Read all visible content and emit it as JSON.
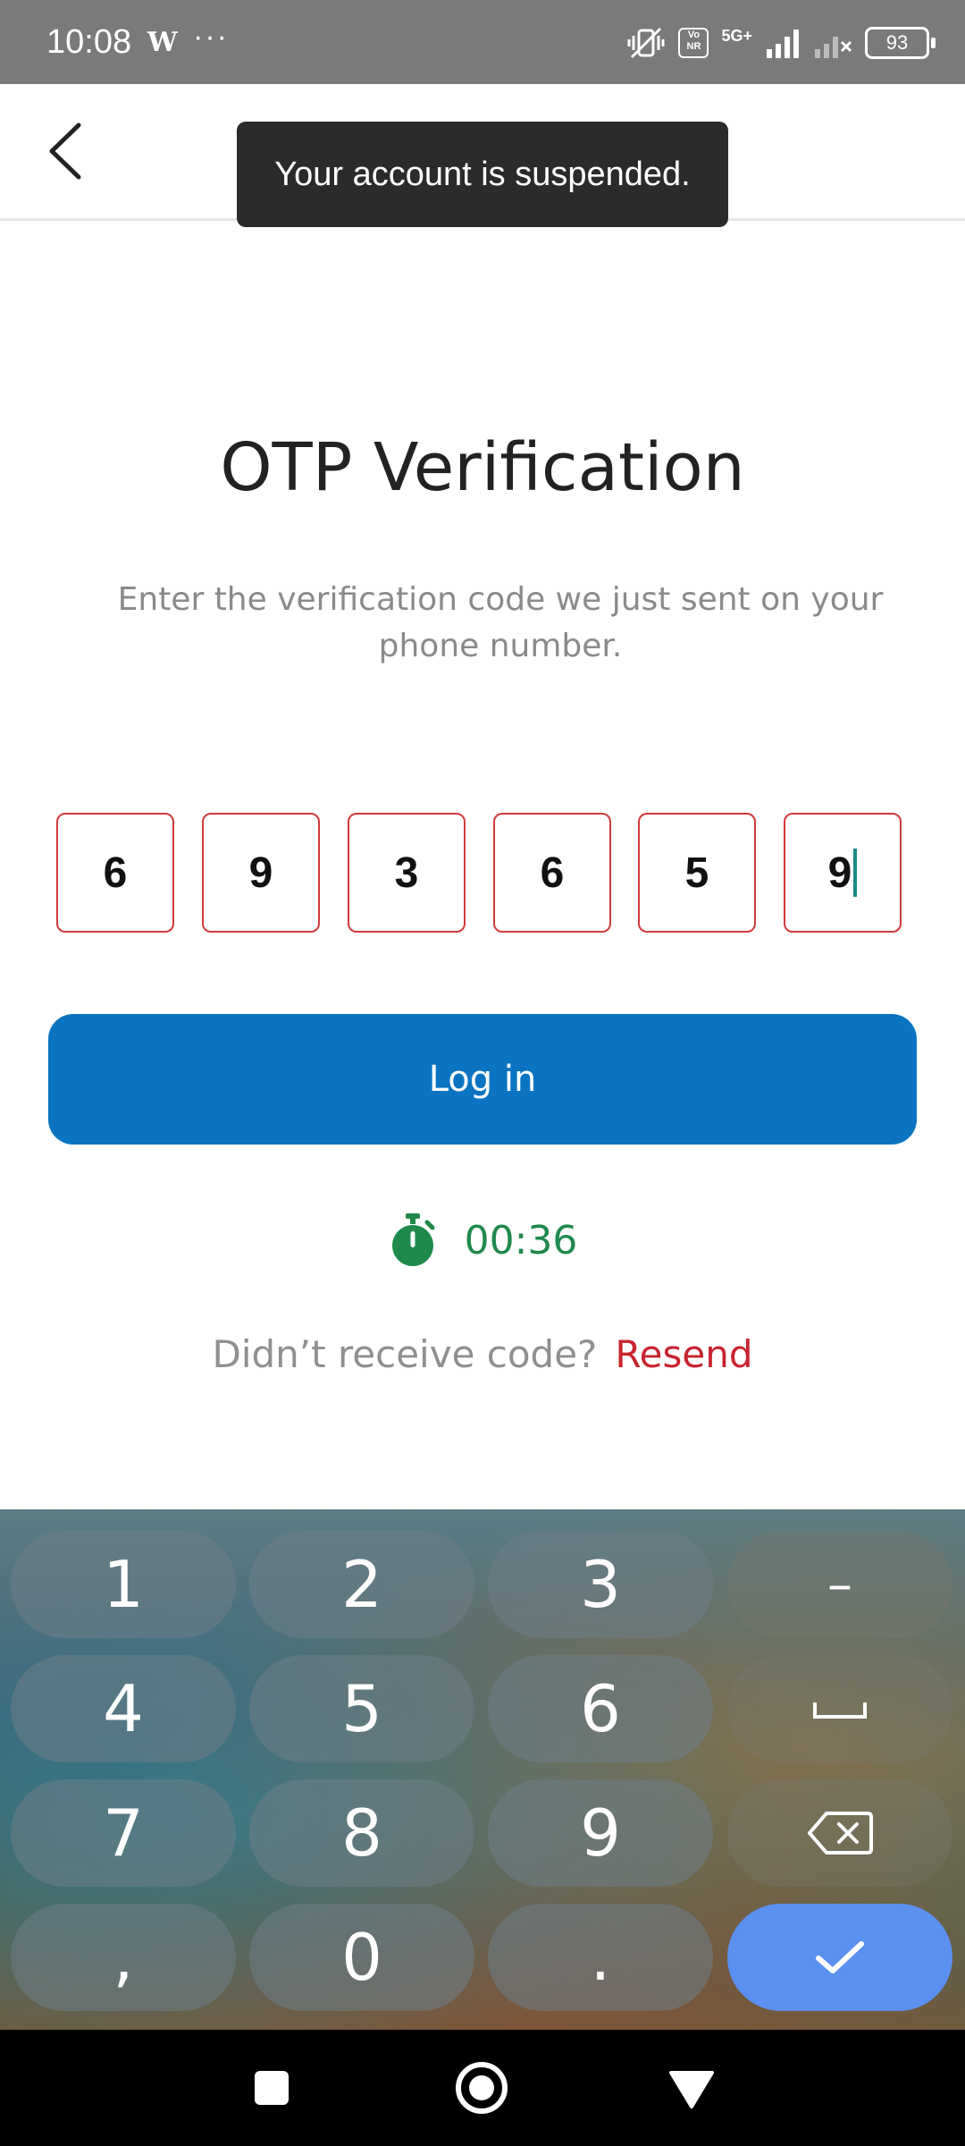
{
  "status_bar": {
    "time": "10:08",
    "carrier_glyph": "W",
    "more_dots": "···",
    "vonr": "Vo NR",
    "network": "5G+",
    "battery": "93"
  },
  "header": {
    "back_icon": "chevron-left-icon"
  },
  "toast": {
    "message": "Your account is suspended."
  },
  "page": {
    "title": "OTP Verification",
    "subtitle": "Enter the verification code we just sent on your phone number."
  },
  "otp": {
    "digits": [
      "6",
      "9",
      "3",
      "6",
      "5",
      "9"
    ],
    "border_color": "#d23a3a"
  },
  "login_button": {
    "label": "Log in",
    "color": "#0a74c2"
  },
  "timer": {
    "value": "00:36",
    "icon": "stopwatch-icon",
    "color": "#1f8a4c"
  },
  "resend": {
    "question": "Didn’t receive code?",
    "link": "Resend",
    "link_color": "#c8242f"
  },
  "keyboard": {
    "keys": [
      "1",
      "2",
      "3",
      "4",
      "5",
      "6",
      "7",
      "8",
      "9",
      ",",
      "0",
      "."
    ],
    "function_keys": [
      "minus-icon",
      "space-icon",
      "backspace-icon",
      "check-icon"
    ],
    "minus_label": "–",
    "enter_color": "#5b8ff0"
  },
  "nav_bar": {
    "icons": [
      "square-icon",
      "home-circle-icon",
      "back-triangle-icon"
    ]
  }
}
